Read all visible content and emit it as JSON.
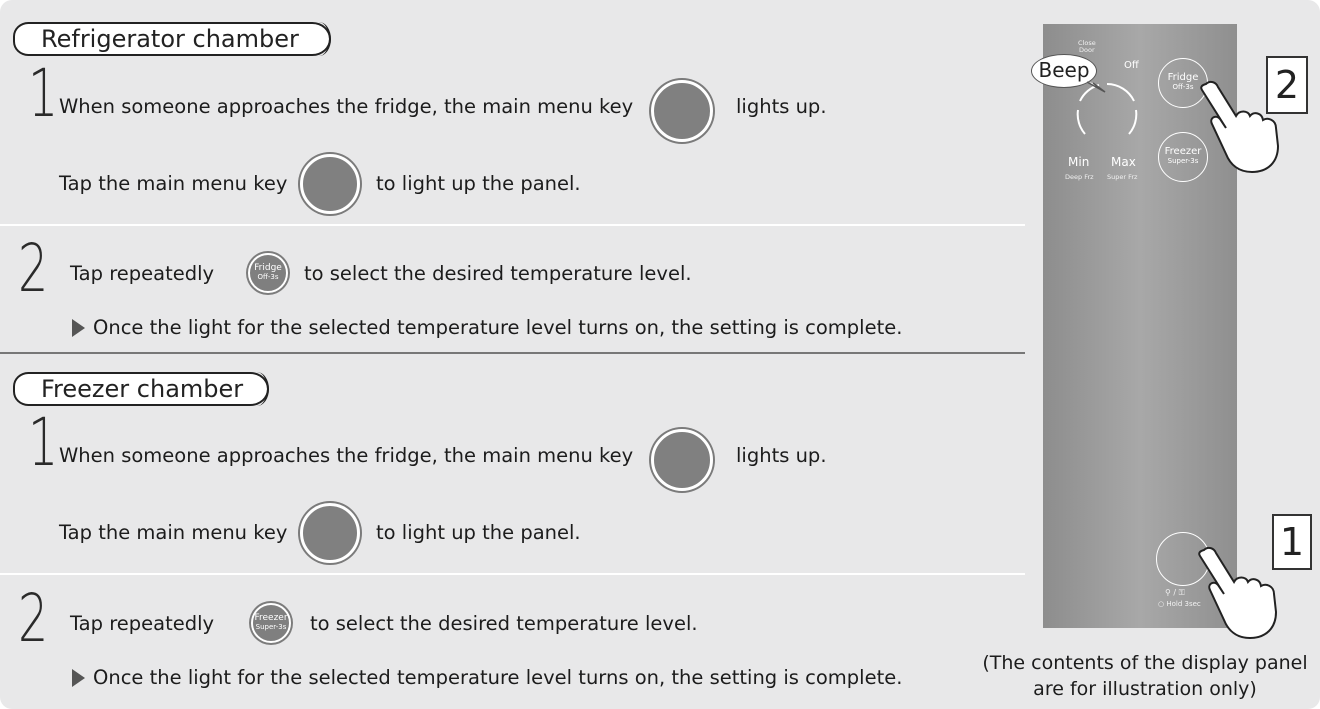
{
  "fridge_section": {
    "title": "Refrigerator chamber",
    "step1_number": "1",
    "step1_line1_before": "When someone approaches the fridge, the main menu key",
    "step1_line1_after": "lights up.",
    "step1_line2_before": "Tap the main menu key",
    "step1_line2_after": "to light up the panel.",
    "step2_number": "2",
    "step2_before": "Tap repeatedly",
    "step2_key_line1": "Fridge",
    "step2_key_line2": "Off-3s",
    "step2_after": "to select the desired temperature level.",
    "step2_note": "Once the light for the selected temperature level turns on, the setting is complete."
  },
  "freezer_section": {
    "title": "Freezer chamber",
    "step1_number": "1",
    "step1_line1_before": "When someone approaches the fridge, the main menu key",
    "step1_line1_after": "lights up.",
    "step1_line2_before": "Tap the main menu key",
    "step1_line2_after": "to light up the panel.",
    "step2_number": "2",
    "step2_before": "Tap repeatedly",
    "step2_key_line1": "Freezer",
    "step2_key_line2": "Super-3s",
    "step2_after": "to select the desired temperature level.",
    "step2_note": "Once the light for the selected temperature level turns on, the setting is complete."
  },
  "panel": {
    "close_door_line1": "Close",
    "close_door_line2": "Door",
    "beep": "Beep",
    "off": "Off",
    "min": "Min",
    "max": "Max",
    "deep_frz": "Deep Frz",
    "super_frz": "Super Frz",
    "fridge_btn_line1": "Fridge",
    "fridge_btn_line2": "Off-3s",
    "freezer_btn_line1": "Freezer",
    "freezer_btn_line2": "Super-3s",
    "lock_label": "⚲ / ⚿",
    "hold_label": "Hold 3sec",
    "callout_2": "2",
    "callout_1": "1"
  },
  "caption_line1": "(The contents of the display panel",
  "caption_line2": "are for illustration only)",
  "colors": {
    "background": "#e8e8e9",
    "key_gray": "#808080",
    "panel_gray": "#9a9a9a"
  }
}
